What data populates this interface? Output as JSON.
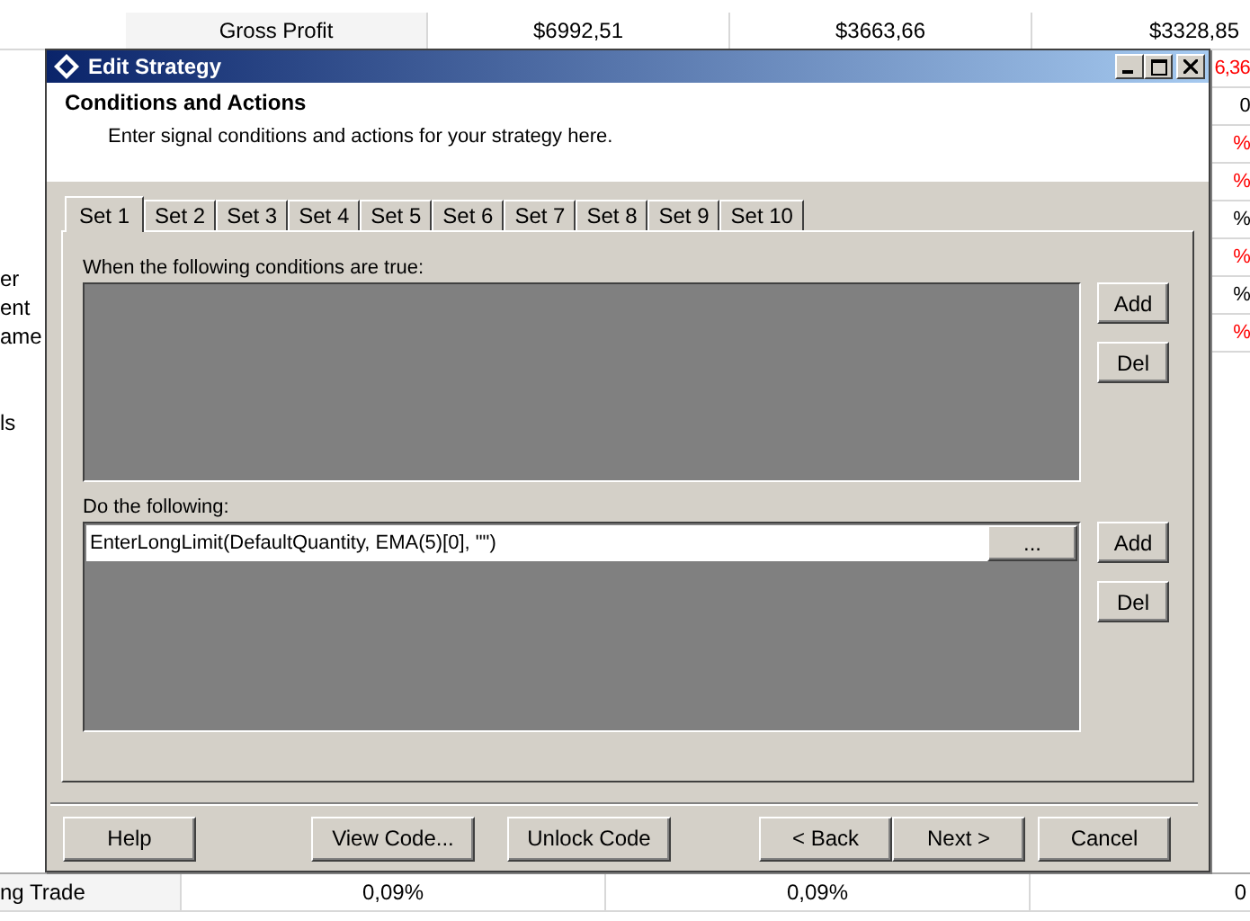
{
  "background": {
    "top_row": [
      "Gross Profit",
      "$6992,51",
      "$3663,66",
      "$3328,85"
    ],
    "left_fragments": [
      "er",
      "ent",
      "ame",
      "ls"
    ],
    "right_fragments": [
      {
        "text": "6,36",
        "color": "#ff0000"
      },
      {
        "text": "0",
        "color": "#000000"
      },
      {
        "text": "%",
        "color": "#ff0000"
      },
      {
        "text": "%",
        "color": "#ff0000"
      },
      {
        "text": "%",
        "color": "#000000"
      },
      {
        "text": "%",
        "color": "#ff0000"
      },
      {
        "text": "%",
        "color": "#000000"
      },
      {
        "text": "%",
        "color": "#ff0000"
      }
    ],
    "bottom_row": [
      "ng Trade",
      "0,09%",
      "0,09%",
      "0"
    ]
  },
  "dialog": {
    "title": "Edit Strategy",
    "header": {
      "title": "Conditions and Actions",
      "subtitle": "Enter signal conditions and actions for your strategy here."
    },
    "tabs": [
      {
        "label": "Set 1",
        "selected": true
      },
      {
        "label": "Set 2",
        "selected": false
      },
      {
        "label": "Set 3",
        "selected": false
      },
      {
        "label": "Set 4",
        "selected": false
      },
      {
        "label": "Set 5",
        "selected": false
      },
      {
        "label": "Set 6",
        "selected": false
      },
      {
        "label": "Set 7",
        "selected": false
      },
      {
        "label": "Set 8",
        "selected": false
      },
      {
        "label": "Set 9",
        "selected": false
      },
      {
        "label": "Set 10",
        "selected": false
      }
    ],
    "conditions": {
      "label": "When the following conditions are true:",
      "buttons": [
        "Add",
        "Del"
      ]
    },
    "actions": {
      "label": "Do the following:",
      "items": [
        {
          "value": "EnterLongLimit(DefaultQuantity, EMA(5)[0], \"\")",
          "button": "..."
        }
      ],
      "buttons": [
        "Add",
        "Del"
      ]
    },
    "footer": {
      "left": [
        "Help"
      ],
      "middle": [
        "View Code...",
        "Unlock Code"
      ],
      "nav": [
        "< Back",
        "Next >"
      ],
      "right": [
        "Cancel"
      ]
    }
  }
}
